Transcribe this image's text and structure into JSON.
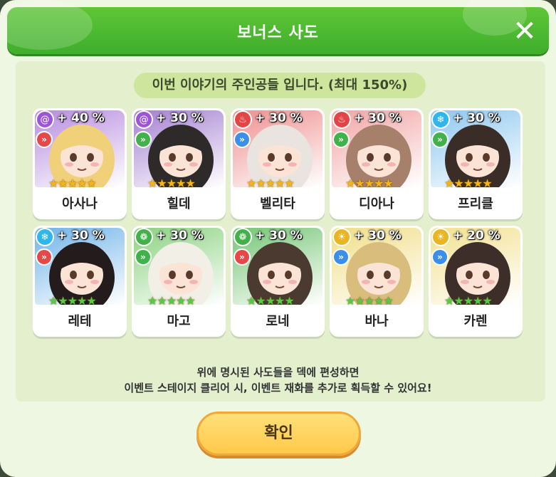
{
  "dialog": {
    "title": "보너스 사도",
    "header": "이번 이야기의 주인공들 입니다. (최대 150%)",
    "footer_line1": "위에 명시된 사도들을 덱에 편성하면",
    "footer_line2": "이벤트 스테이지 클리어 시, 이벤트 재화를 추가로 획득할 수 있어요!",
    "confirm_label": "확인",
    "close_label": "✕"
  },
  "cards": [
    {
      "name": "아사나",
      "bonus": "+ 40 %",
      "stars": "★★★★★",
      "star_color": "#f3b51a",
      "element": "swirl-icon",
      "element_color": "#9b55d6",
      "class_color": "#e54848",
      "bg": "#b78be0",
      "hair": "#f1d07a"
    },
    {
      "name": "힐데",
      "bonus": "+ 30 %",
      "stars": "★★★★★",
      "star_color": "#f3b51a",
      "element": "swirl-icon",
      "element_color": "#9b55d6",
      "class_color": "#3fb24a",
      "bg": "#a47fd1",
      "hair": "#2f2a2a"
    },
    {
      "name": "벨리타",
      "bonus": "+ 30 %",
      "stars": "★★★★★",
      "star_color": "#f3b51a",
      "element": "fire-icon",
      "element_color": "#e24545",
      "class_color": "#3b8fe8",
      "bg": "#ef8f8f",
      "hair": "#e9e4df"
    },
    {
      "name": "디아나",
      "bonus": "+ 30 %",
      "stars": "★★★★★",
      "star_color": "#f3b51a",
      "element": "fire-icon",
      "element_color": "#e24545",
      "class_color": "#3fb24a",
      "bg": "#f2a4a4",
      "hair": "#a6806a"
    },
    {
      "name": "프리클",
      "bonus": "+ 30 %",
      "stars": "★★★★★",
      "star_color": "#f3b51a",
      "element": "snow-icon",
      "element_color": "#2fb6ea",
      "class_color": "#3fb24a",
      "bg": "#8cc7ef",
      "hair": "#3a2c26"
    },
    {
      "name": "레테",
      "bonus": "+ 30 %",
      "stars": "★★★★★",
      "star_color": "#56c949",
      "element": "snow-icon",
      "element_color": "#2fb6ea",
      "class_color": "#e54848",
      "bg": "#6fb3e9",
      "hair": "#241c1c"
    },
    {
      "name": "마고",
      "bonus": "+ 30 %",
      "stars": "★★★★★",
      "star_color": "#56c949",
      "element": "leaf-icon",
      "element_color": "#43b04a",
      "class_color": "#3fb24a",
      "bg": "#8ad27f",
      "hair": "#f1efe6"
    },
    {
      "name": "로네",
      "bonus": "+ 30 %",
      "stars": "★★★★★",
      "star_color": "#56c949",
      "element": "leaf-icon",
      "element_color": "#43b04a",
      "class_color": "#e54848",
      "bg": "#74c574",
      "hair": "#4b3a30"
    },
    {
      "name": "바나",
      "bonus": "+ 30 %",
      "stars": "★★★★★",
      "star_color": "#56c949",
      "element": "sun-icon",
      "element_color": "#e8b622",
      "class_color": "#3b8fe8",
      "bg": "#f1de86",
      "hair": "#d8bd7d"
    },
    {
      "name": "카렌",
      "bonus": "+ 20 %",
      "stars": "★★★★★",
      "star_color": "#56c949",
      "element": "sun-icon",
      "element_color": "#e8b622",
      "class_color": "#3b8fe8",
      "bg": "#f2e18f",
      "hair": "#3d2e2a"
    }
  ]
}
